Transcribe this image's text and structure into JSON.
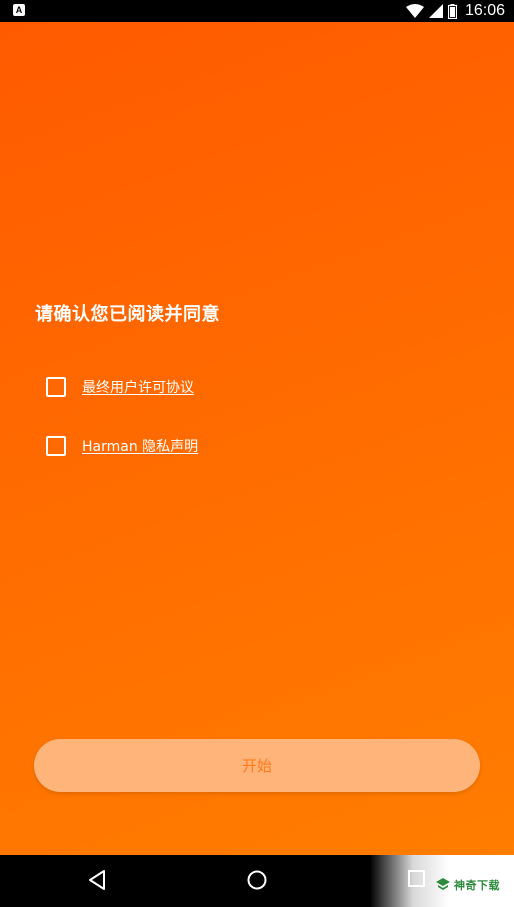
{
  "status_bar": {
    "app_indicator": "A",
    "time": "16:06",
    "icons": [
      "wifi-icon",
      "cell-signal-icon",
      "battery-icon"
    ]
  },
  "consent": {
    "heading": "请确认您已阅读并同意",
    "items": [
      {
        "label": "最终用户许可协议",
        "checked": false
      },
      {
        "label": "Harman 隐私声明",
        "checked": false
      }
    ]
  },
  "start_button": {
    "label": "开始"
  },
  "nav_bar": {
    "icons": [
      "back-icon",
      "home-icon",
      "recents-icon"
    ]
  },
  "watermark": {
    "text": "神奇下载"
  },
  "colors": {
    "gradient_start": "#ff5a00",
    "gradient_end": "#ff7d00",
    "button_bg": "#ffb57a",
    "button_text": "#ff7a1c"
  }
}
